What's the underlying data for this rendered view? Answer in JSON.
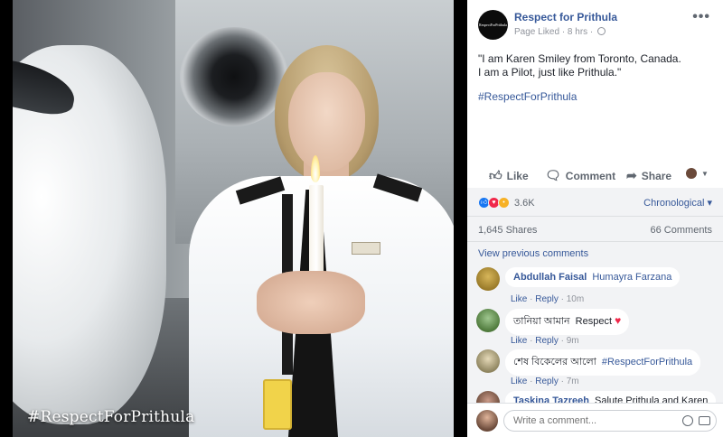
{
  "photo": {
    "overlay_hashtag": "#RespectForPrithula"
  },
  "post": {
    "page_name": "Respect for Prithula",
    "avatar_text": "RespectForPrithula",
    "meta": "Page Liked · 8 hrs ·",
    "more": "•••",
    "text_line1": "\"I am Karen Smiley from Toronto, Canada.",
    "text_line2": "I am a Pilot, just like Prithula.\"",
    "hashtag": "#RespectForPrithula"
  },
  "actions": {
    "like": "Like",
    "comment": "Comment",
    "share": "Share"
  },
  "stats": {
    "reactions": "3.6K",
    "order": "Chronological ▾",
    "shares": "1,645 Shares",
    "comments": "66 Comments",
    "view_previous": "View previous comments"
  },
  "comments": [
    {
      "author": "Abdullah Faisal",
      "tagged": "Humayra Farzana",
      "like": "Like",
      "reply": "Reply",
      "time": "10m"
    },
    {
      "author": "তানিয়া আমান",
      "text": "Respect",
      "like": "Like",
      "reply": "Reply",
      "time": "9m"
    },
    {
      "author": "শেষ বিকেলের আলো",
      "hashtag": "#RespectForPrithula",
      "like": "Like",
      "reply": "Reply",
      "time": "7m"
    },
    {
      "author": "Taskina Tazreeh",
      "text": "Salute Prithula and Karen"
    }
  ],
  "composer": {
    "placeholder": "Write a comment..."
  },
  "colors": {
    "link": "#365899",
    "love": "#f0284a",
    "like": "#1877f2"
  }
}
